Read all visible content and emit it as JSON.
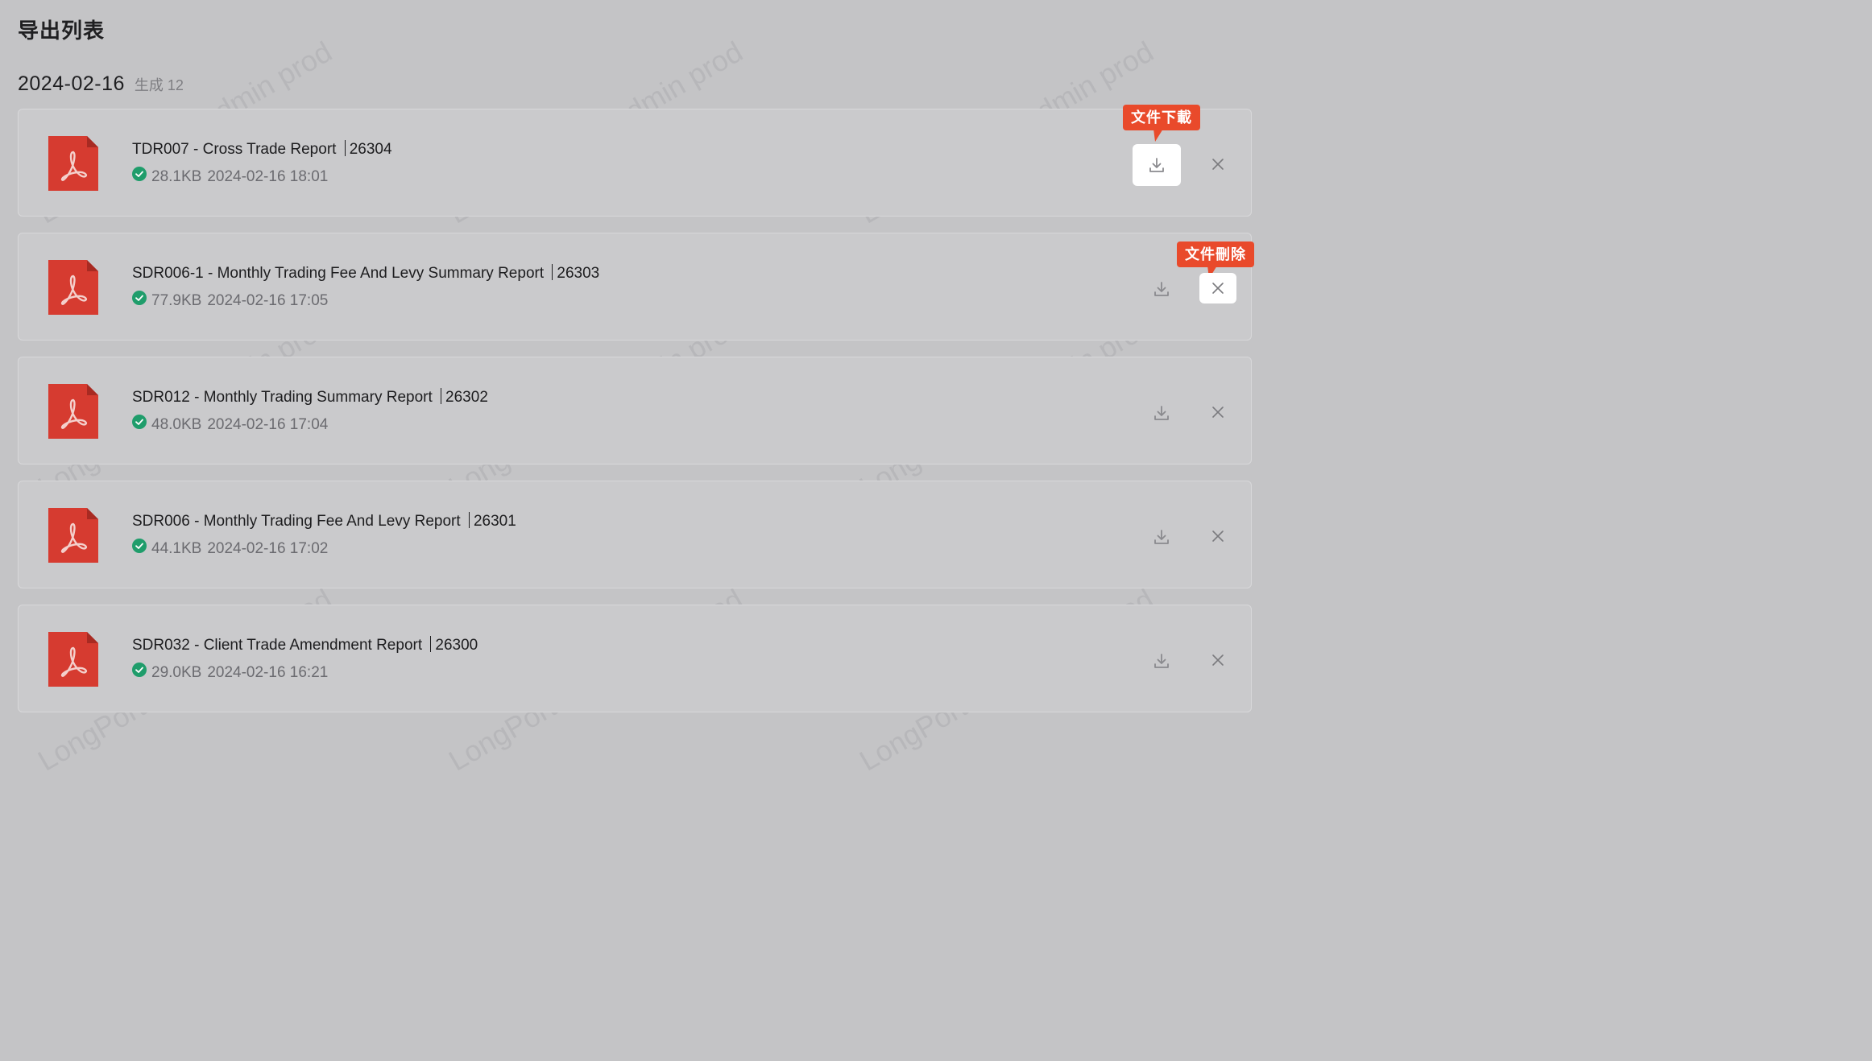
{
  "page": {
    "title": "导出列表"
  },
  "group": {
    "date": "2024-02-16",
    "count_label": "生成 12"
  },
  "watermark": "LongPort Test Admin prod",
  "tooltips": {
    "download": "文件下載",
    "delete": "文件刪除"
  },
  "files": [
    {
      "code_title": "TDR007 - Cross Trade Report",
      "id": "26304",
      "size": "28.1KB",
      "time": "2024-02-16 18:01",
      "status": "success"
    },
    {
      "code_title": "SDR006-1 - Monthly Trading Fee And Levy Summary Report",
      "id": "26303",
      "size": "77.9KB",
      "time": "2024-02-16 17:05",
      "status": "success"
    },
    {
      "code_title": "SDR012 - Monthly Trading Summary Report",
      "id": "26302",
      "size": "48.0KB",
      "time": "2024-02-16 17:04",
      "status": "success"
    },
    {
      "code_title": "SDR006 - Monthly Trading Fee And Levy Report",
      "id": "26301",
      "size": "44.1KB",
      "time": "2024-02-16 17:02",
      "status": "success"
    },
    {
      "code_title": "SDR032 - Client Trade Amendment Report",
      "id": "26300",
      "size": "29.0KB",
      "time": "2024-02-16 16:21",
      "status": "success"
    }
  ],
  "icons": {
    "file": "pdf-file-icon",
    "status": "check-circle-icon",
    "download": "download-icon",
    "delete": "close-icon"
  },
  "colors": {
    "pdf_red": "#d63b30",
    "success_green": "#1f9d6b",
    "tooltip_orange": "#e94a2b"
  }
}
